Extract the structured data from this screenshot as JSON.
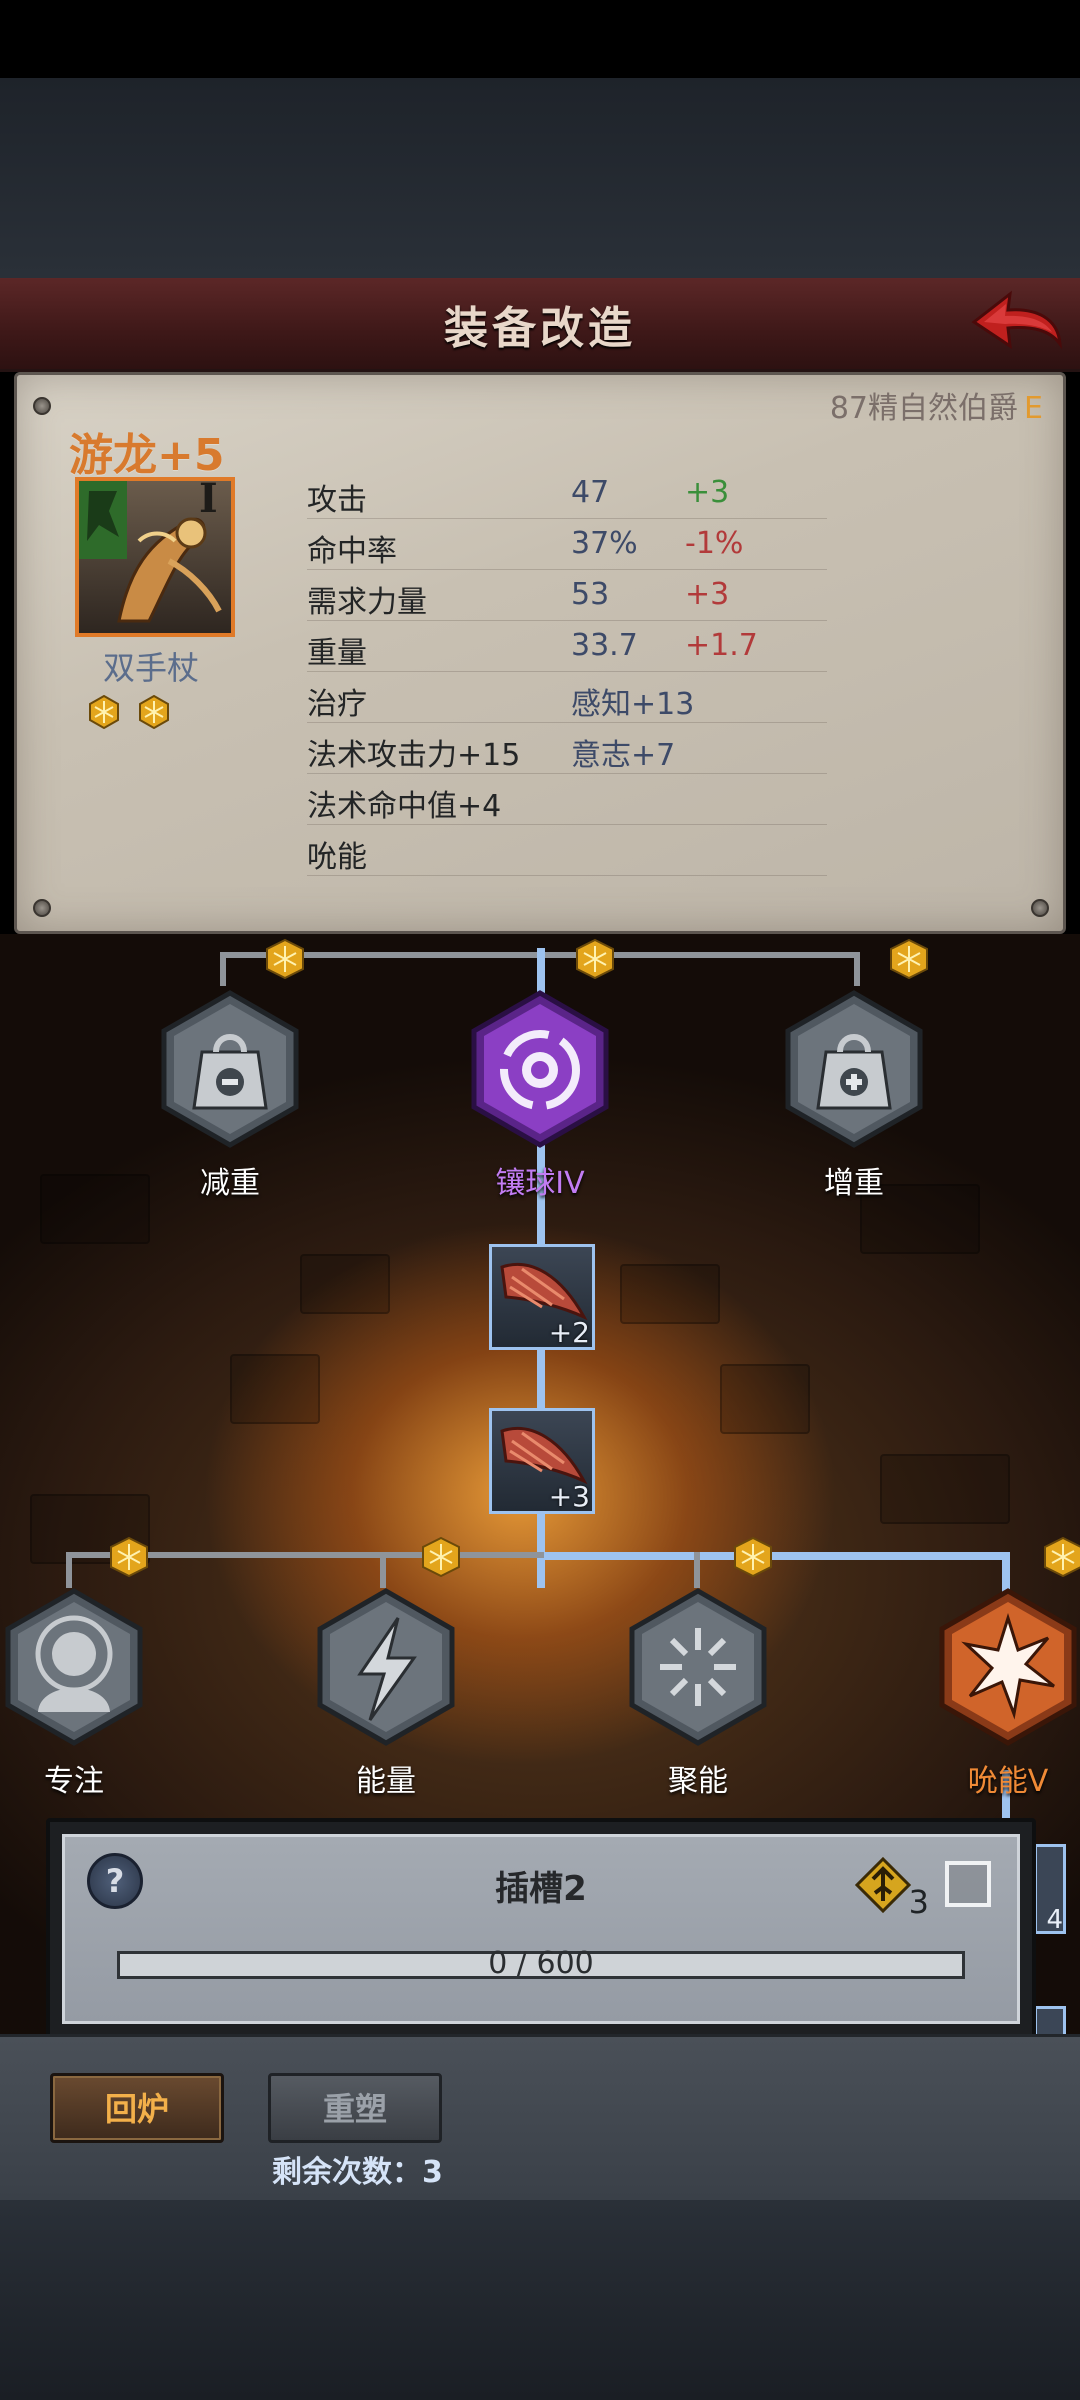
{
  "header": {
    "title": "装备改造"
  },
  "item": {
    "rank_text": "87精自然伯爵",
    "rank_grade": "E",
    "name": "游龙+5",
    "tier": "I",
    "type": "双手杖",
    "sockets": 2
  },
  "stats": [
    {
      "label": "攻击",
      "value": "47",
      "delta": "+3",
      "delta_kind": "pos"
    },
    {
      "label": "命中率",
      "value": "37%",
      "delta": "-1%",
      "delta_kind": "neg"
    },
    {
      "label": "需求力量",
      "value": "53",
      "delta": "+3",
      "delta_kind": "neg"
    },
    {
      "label": "重量",
      "value": "33.7",
      "delta": "+1.7",
      "delta_kind": "neg"
    },
    {
      "label": "治疗",
      "value": "感知+13",
      "delta": "",
      "delta_kind": ""
    },
    {
      "label": "法术攻击力+15",
      "value": "意志+7",
      "delta": "",
      "delta_kind": ""
    },
    {
      "label": "法术命中值+4",
      "value": "",
      "delta": "",
      "delta_kind": ""
    },
    {
      "label": "吮能",
      "value": "",
      "delta": "",
      "delta_kind": ""
    }
  ],
  "tree": {
    "top_nodes": [
      {
        "label": "减重",
        "icon": "weight-minus-icon",
        "style": "normal"
      },
      {
        "label": "镶球IV",
        "icon": "orb-socket-icon",
        "style": "active"
      },
      {
        "label": "增重",
        "icon": "weight-plus-icon",
        "style": "normal"
      }
    ],
    "materials": [
      {
        "count": "+2",
        "icon": "claw-material-icon"
      },
      {
        "count": "+3",
        "icon": "claw-material-icon"
      }
    ],
    "bottom_nodes": [
      {
        "label": "专注",
        "icon": "focus-icon",
        "style": "normal"
      },
      {
        "label": "能量",
        "icon": "lightning-icon",
        "style": "normal"
      },
      {
        "label": "聚能",
        "icon": "burst-icon",
        "style": "normal"
      },
      {
        "label": "吮能V",
        "icon": "drain-icon",
        "style": "selected"
      }
    ],
    "side_count": "4"
  },
  "slot": {
    "title": "插槽2",
    "count": "3",
    "progress_text": "0 / 600",
    "progress": 0
  },
  "actions": {
    "recycle": "回炉",
    "reforge": "重塑",
    "remaining": "剩余次数：3"
  },
  "colors": {
    "accent_orange": "#e07a28",
    "active_blue": "#9ec3ef",
    "active_purple": "#8b3fc4"
  }
}
